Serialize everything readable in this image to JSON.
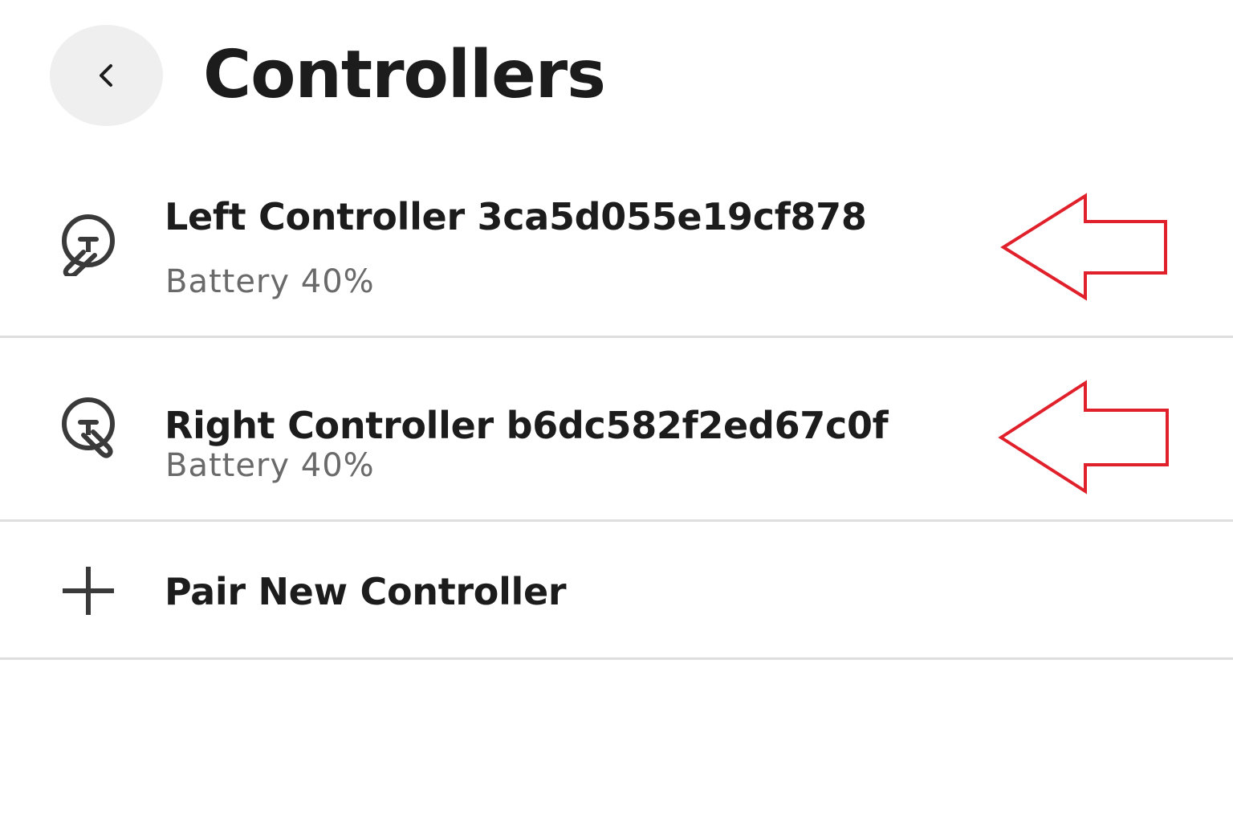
{
  "header": {
    "title": "Controllers",
    "back_icon": "chevron-left-icon"
  },
  "controllers": [
    {
      "name": "Left Controller 3ca5d055e19cf878",
      "battery": "Battery 40%",
      "icon": "left-controller-icon"
    },
    {
      "name": "Right Controller b6dc582f2ed67c0f",
      "battery": "Battery 40%",
      "icon": "right-controller-icon"
    }
  ],
  "pair": {
    "label": "Pair New Controller",
    "icon": "plus-icon"
  },
  "annotations": {
    "arrow_color": "#e0202a"
  },
  "colors": {
    "text_primary": "#1c1c1c",
    "text_secondary": "#6a6a6a",
    "divider": "#dedede",
    "back_button_bg": "#efefef"
  }
}
